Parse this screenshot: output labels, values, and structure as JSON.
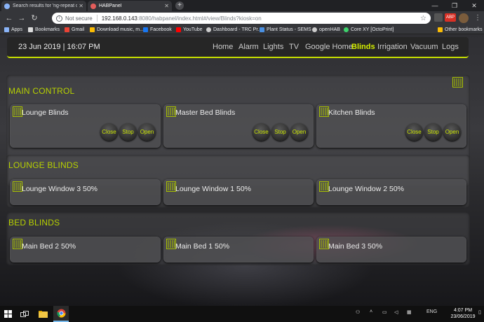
{
  "browser": {
    "tabs": [
      {
        "title": "Search results for 'ng-repeat ord",
        "active": false
      },
      {
        "title": "HABPanel",
        "active": true
      }
    ],
    "security_label": "Not secure",
    "url_host": "192.168.0.143",
    "url_path": ":8080/habpanel/index.html#/view/Blinds?kiosk=on",
    "ext_badge": "ABP",
    "bookmarks": [
      {
        "label": "Apps",
        "icon": "apps-icon"
      },
      {
        "label": "Bookmarks",
        "icon": "star-icon"
      },
      {
        "label": "Gmail",
        "icon": "gmail-icon"
      },
      {
        "label": "Download music, m...",
        "icon": "music-icon"
      },
      {
        "label": "Facebook",
        "icon": "facebook-icon"
      },
      {
        "label": "YouTube",
        "icon": "youtube-icon"
      },
      {
        "label": "Dashboard - TRC Pr...",
        "icon": "globe-icon"
      },
      {
        "label": "Plant Status - SEMS",
        "icon": "plant-icon"
      },
      {
        "label": "openHAB",
        "icon": "globe-icon"
      },
      {
        "label": "Core XY [OctoPrint]",
        "icon": "octoprint-icon"
      }
    ],
    "other_bookmarks": "Other bookmarks"
  },
  "navbar": {
    "datetime": "23 Jun 2019 | 16:07 PM",
    "links": [
      "Home",
      "Alarm",
      "Lights",
      "TV",
      "Google Home",
      "Blinds",
      "Irrigation",
      "Vacuum",
      "Logs"
    ],
    "active": "Blinds"
  },
  "main_control": {
    "title": "MAIN CONTROL",
    "tiles": [
      {
        "label": "Lounge Blinds",
        "buttons": [
          "Close",
          "Stop",
          "Open"
        ]
      },
      {
        "label": "Master Bed Blinds",
        "buttons": [
          "Close",
          "Stop",
          "Open"
        ]
      },
      {
        "label": "Kitchen Blinds",
        "buttons": [
          "Close",
          "Stop",
          "Open"
        ]
      }
    ]
  },
  "lounge_blinds": {
    "title": "LOUNGE BLINDS",
    "tiles": [
      {
        "label": "Lounge Window 3 50%"
      },
      {
        "label": "Lounge Window 1 50%"
      },
      {
        "label": "Lounge Window 2 50%"
      }
    ]
  },
  "bed_blinds": {
    "title": "BED BLINDS",
    "tiles": [
      {
        "label": "Main Bed 2 50%"
      },
      {
        "label": "Main Bed 1 50%"
      },
      {
        "label": "Main Bed 3 50%"
      }
    ]
  },
  "taskbar": {
    "language": "ENG",
    "time": "4:07 PM",
    "date": "23/06/2019"
  },
  "colors": {
    "accent": "#c8e000",
    "button_text": "#c9e400",
    "section_title": "#b7d100"
  }
}
